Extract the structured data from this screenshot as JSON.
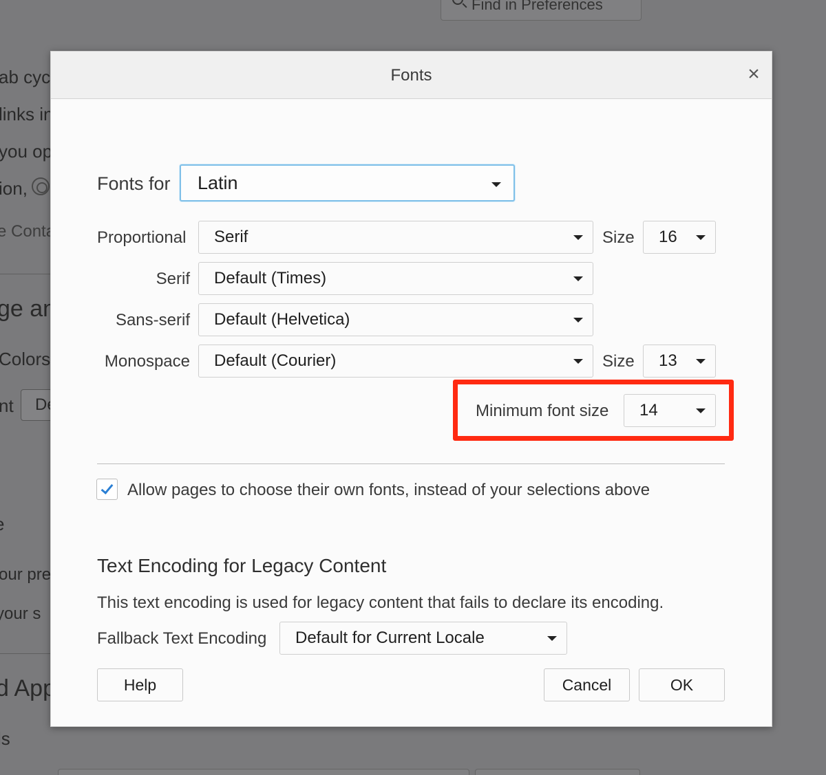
{
  "background": {
    "search_placeholder": "Find in Preferences",
    "fragments": {
      "tab_cycle": "ab cycl",
      "links_in": "links in",
      "you_op": "you op",
      "ion": "ion,",
      "contai": "e Conta",
      "lang_heading": "ge an",
      "colors": "Colors",
      "nt": "nt",
      "de": "De",
      "e": "e",
      "our_pref": "our pref",
      "your_s": "your s",
      "apps_heading": "d App",
      "ls": "ls"
    }
  },
  "dialog": {
    "title": "Fonts",
    "close_symbol": "×",
    "fonts_for": {
      "label": "Fonts for",
      "value": "Latin"
    },
    "proportional": {
      "label": "Proportional",
      "value": "Serif",
      "size_label": "Size",
      "size_value": "16"
    },
    "serif": {
      "label": "Serif",
      "value": "Default (Times)"
    },
    "sans_serif": {
      "label": "Sans-serif",
      "value": "Default (Helvetica)"
    },
    "monospace": {
      "label": "Monospace",
      "value": "Default (Courier)",
      "size_label": "Size",
      "size_value": "13"
    },
    "minimum_font_size": {
      "label": "Minimum font size",
      "value": "14"
    },
    "allow_pages": {
      "label": "Allow pages to choose their own fonts, instead of your selections above",
      "checked": true
    },
    "encoding": {
      "heading": "Text Encoding for Legacy Content",
      "description": "This text encoding is used for legacy content that fails to declare its encoding.",
      "fallback_label": "Fallback Text Encoding",
      "fallback_value": "Default for Current Locale"
    },
    "buttons": {
      "help": "Help",
      "cancel": "Cancel",
      "ok": "OK"
    }
  },
  "colors": {
    "highlight": "#ff2a12",
    "focus_ring": "#7fc0e8",
    "checkbox_tick": "#2a7fd4",
    "overlay": "#7a7a7c"
  }
}
